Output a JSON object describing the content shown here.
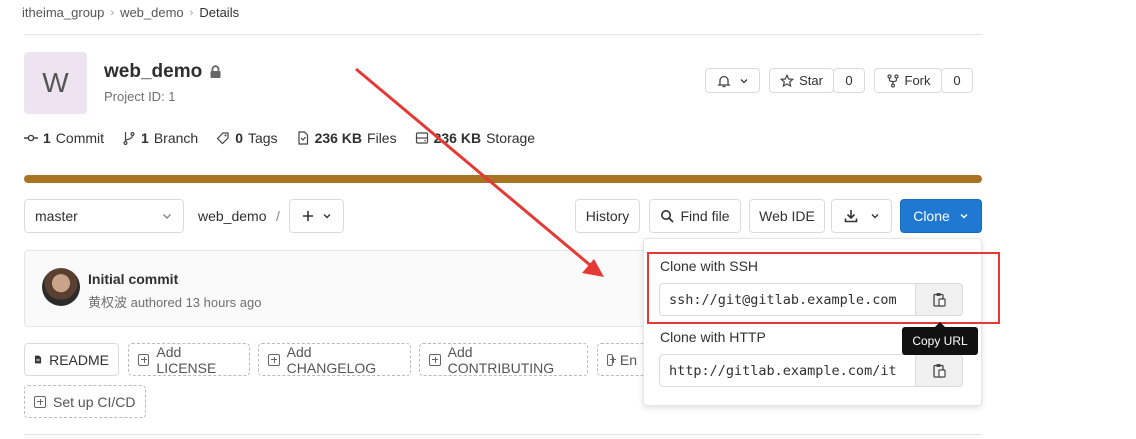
{
  "breadcrumb": {
    "group": "itheima_group",
    "project": "web_demo",
    "current": "Details"
  },
  "project": {
    "avatar_letter": "W",
    "name": "web_demo",
    "id_text": "Project ID: 1"
  },
  "header_actions": {
    "star_label": "Star",
    "star_count": "0",
    "fork_label": "Fork",
    "fork_count": "0"
  },
  "stats": {
    "commits_count": "1",
    "commits_label": "Commit",
    "branches_count": "1",
    "branches_label": "Branch",
    "tags_count": "0",
    "tags_label": "Tags",
    "files_size": "236 KB",
    "files_label": "Files",
    "storage_size": "236 KB",
    "storage_label": "Storage"
  },
  "toolbar": {
    "branch": "master",
    "path": "web_demo",
    "path_sep": "/",
    "history_label": "History",
    "find_file_label": "Find file",
    "web_ide_label": "Web IDE",
    "clone_label": "Clone"
  },
  "commit": {
    "title": "Initial commit",
    "author": "黄权波",
    "meta": "authored 13 hours ago"
  },
  "actions": {
    "readme": "README",
    "license": "Add LICENSE",
    "changelog": "Add CHANGELOG",
    "contributing": "Add CONTRIBUTING",
    "enable": "En",
    "cicd": "Set up CI/CD"
  },
  "clone_panel": {
    "ssh_label": "Clone with SSH",
    "ssh_url": "ssh://git@gitlab.example.com",
    "http_label": "Clone with HTTP",
    "http_url": "http://gitlab.example.com/it",
    "tooltip": "Copy URL"
  },
  "colors": {
    "accent_blue": "#1f78d1",
    "progress_bar": "#a97324",
    "highlight_red": "#e53935"
  }
}
